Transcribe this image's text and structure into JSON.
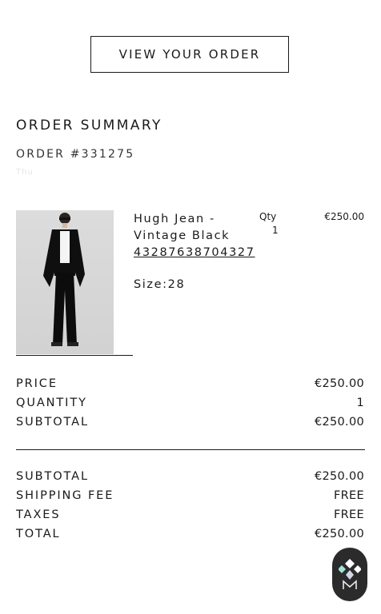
{
  "view_button": "VIEW YOUR ORDER",
  "summary_title": "ORDER SUMMARY",
  "order_number": "ORDER #331275",
  "faded_text": "Thu",
  "item": {
    "name": "Hugh Jean - Vintage Black",
    "sku": "43287638704327",
    "size": "Size:28",
    "qty_label": "Qty",
    "qty": "1",
    "price": "€250.00"
  },
  "line_totals": [
    {
      "label": "PRICE",
      "value": "€250.00"
    },
    {
      "label": "QUANTITY",
      "value": "1"
    },
    {
      "label": "SUBTOTAL",
      "value": "€250.00"
    }
  ],
  "order_totals": [
    {
      "label": "SUBTOTAL",
      "value": "€250.00"
    },
    {
      "label": "SHIPPING FEE",
      "value": "FREE"
    },
    {
      "label": "TAXES",
      "value": "FREE"
    },
    {
      "label": "TOTAL",
      "value": "€250.00"
    }
  ],
  "icons": {
    "badge": "diamond-monogram-icon"
  },
  "colors": {
    "text": "#1a1a1a",
    "badge_bg": "#2b2b2b",
    "badge_accent": "#9fe3d3"
  }
}
